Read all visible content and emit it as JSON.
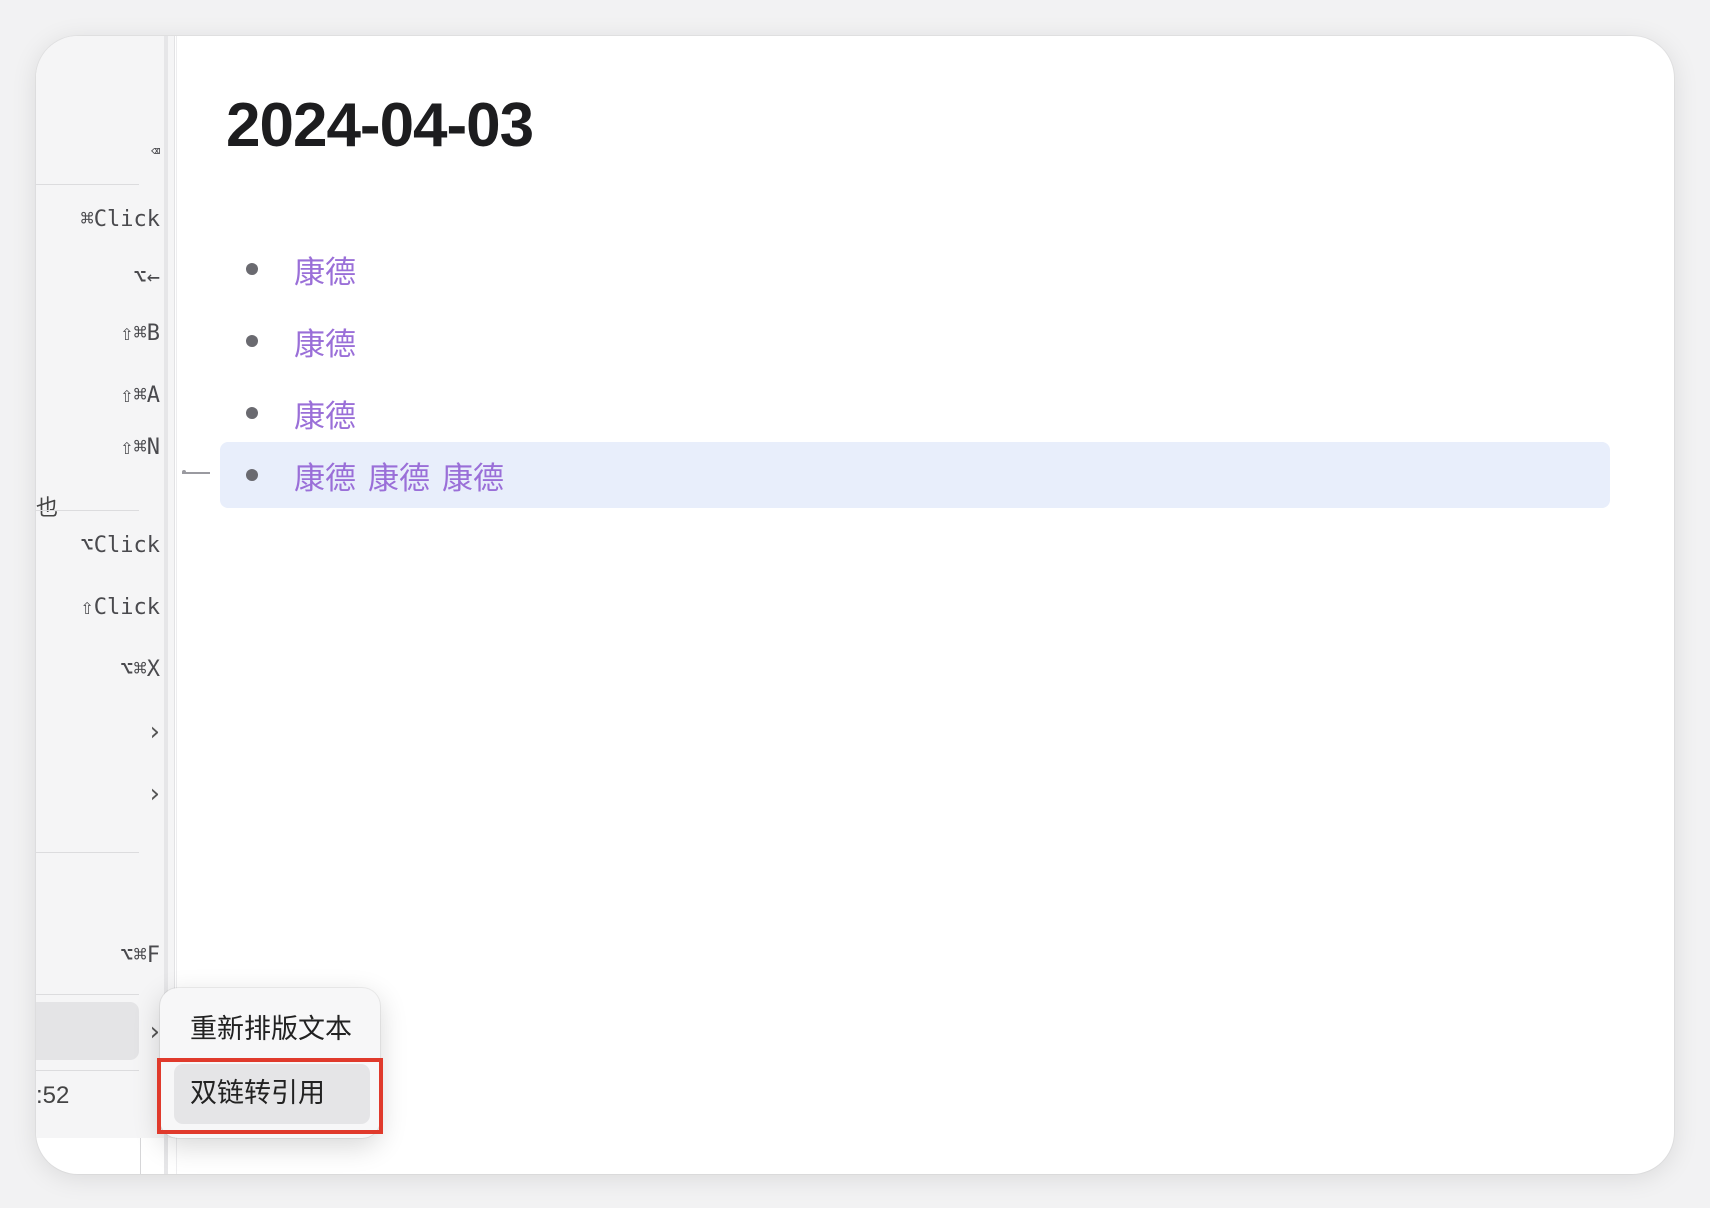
{
  "page": {
    "title": "2024-04-03"
  },
  "blocks": [
    {
      "refs": [
        "康德"
      ]
    },
    {
      "refs": [
        "康德"
      ]
    },
    {
      "refs": [
        "康德"
      ]
    },
    {
      "refs": [
        "康德",
        "康德",
        "康德"
      ]
    }
  ],
  "context_menu": {
    "items": [
      {
        "shortcut": "⌫",
        "icon": "delete-key-icon"
      },
      {
        "shortcut": "⌘Click"
      },
      {
        "shortcut": "⌥←"
      },
      {
        "shortcut": "⇧⌘B"
      },
      {
        "shortcut": "⇧⌘A"
      },
      {
        "shortcut": "⇧⌘N",
        "cut_glyph": "也"
      },
      {
        "shortcut": "⌥Click"
      },
      {
        "shortcut": "⇧Click"
      },
      {
        "shortcut": "⌥⌘X"
      },
      {
        "icon": "chevron-right-icon"
      },
      {
        "icon": "chevron-right-icon"
      },
      {
        "shortcut": "⌥⌘F"
      },
      {
        "icon": "chevron-right-icon",
        "highlighted": true
      }
    ],
    "footer_time": ":52"
  },
  "submenu": {
    "items": [
      {
        "label": "重新排版文本"
      },
      {
        "label": "双链转引用",
        "highlighted": true
      }
    ]
  },
  "colors": {
    "reference_link": "#9a6fd8",
    "active_block_bg": "#e8eefb",
    "annotation_box": "#e03a2c"
  }
}
